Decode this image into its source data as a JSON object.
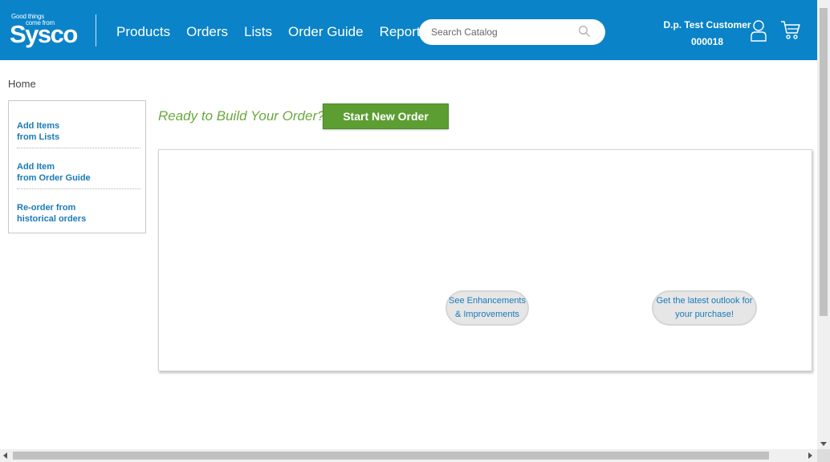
{
  "header": {
    "logo_tagline_1": "Good things",
    "logo_tagline_2": "come from",
    "logo_brand": "Sysco",
    "nav": [
      "Products",
      "Orders",
      "Lists",
      "Order Guide",
      "Reports"
    ],
    "search_placeholder": "Search Catalog",
    "customer_name": "D.p. Test Customer",
    "customer_id": "000018",
    "bg_color": "#0a83c8"
  },
  "breadcrumb": "Home",
  "sidebar": {
    "items": [
      {
        "line1": "Add Items",
        "line2": "from Lists"
      },
      {
        "line1": "Add Item",
        "line2": "from Order Guide"
      },
      {
        "line1": "Re-order from",
        "line2": "historical orders"
      }
    ]
  },
  "main": {
    "prompt": "Ready to Build Your Order?",
    "start_button": "Start New Order",
    "pill_1": {
      "line1": "See Enhancements",
      "line2": "& Improvements"
    },
    "pill_2": {
      "line1": "Get the latest outlook for",
      "line2": "your purchase!"
    }
  },
  "colors": {
    "accent_green": "#5c9e31",
    "link_blue": "#1a7ab8"
  }
}
